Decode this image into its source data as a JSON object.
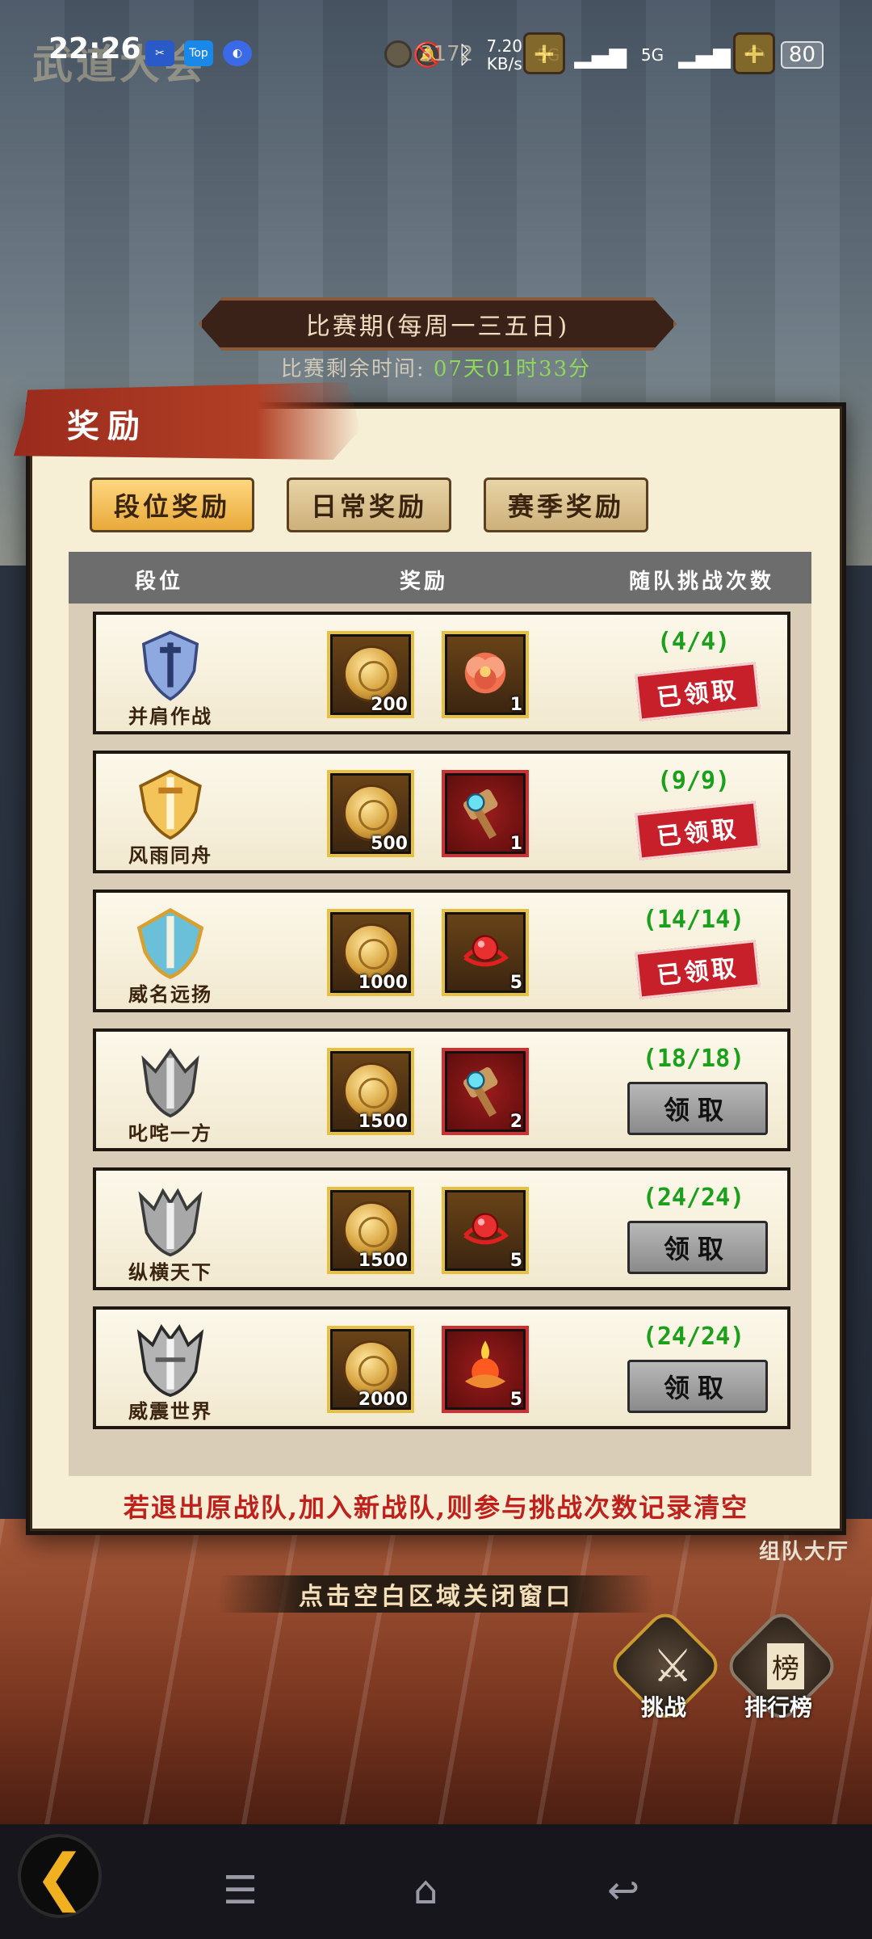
{
  "status_bar": {
    "time": "22:26",
    "net_speed": "7.20\nKB/s",
    "signal_1": "5G",
    "signal_2": "5G",
    "battery": "80",
    "app_icon_2": "Top"
  },
  "hud": {
    "game_title": "武道大会",
    "coins": "3172"
  },
  "period": {
    "banner": "比赛期(每周一三五日)",
    "remaining_label": "比赛剩余时间: ",
    "remaining_value": "07天01时33分"
  },
  "dialog": {
    "title": "奖励",
    "tabs": [
      {
        "label": "段位奖励",
        "active": true
      },
      {
        "label": "日常奖励",
        "active": false
      },
      {
        "label": "赛季奖励",
        "active": false
      }
    ],
    "columns": {
      "rank": "段位",
      "reward": "奖励",
      "count": "随队挑战次数"
    },
    "rows": [
      {
        "rank": "并肩作战",
        "coin_qty": "200",
        "item_qty": "1",
        "item": "peony-flower",
        "count": "(4/4)",
        "status": "已领取"
      },
      {
        "rank": "风雨同舟",
        "coin_qty": "500",
        "item_qty": "1",
        "item": "hammer",
        "count": "(9/9)",
        "status": "已领取"
      },
      {
        "rank": "威名远扬",
        "coin_qty": "1000",
        "item_qty": "5",
        "item": "red-gem",
        "count": "(14/14)",
        "status": "已领取"
      },
      {
        "rank": "叱咤一方",
        "coin_qty": "1500",
        "item_qty": "2",
        "item": "hammer",
        "count": "(18/18)",
        "status": "领取"
      },
      {
        "rank": "纵横天下",
        "coin_qty": "1500",
        "item_qty": "5",
        "item": "red-gem",
        "count": "(24/24)",
        "status": "领取"
      },
      {
        "rank": "威震世界",
        "coin_qty": "2000",
        "item_qty": "5",
        "item": "fire-lotus",
        "count": "(24/24)",
        "status": "领取"
      }
    ],
    "footer_note": "若退出原战队,加入新战队,则参与挑战次数记录清空"
  },
  "close_hint": "点击空白区域关闭窗口",
  "background_ui": {
    "team_hall": "组队大厅",
    "challenge": "挑战",
    "leaderboard": "排行榜",
    "leaderboard_badge": "榜"
  },
  "colors": {
    "claimed_red": "#c8202a",
    "count_green": "#1aa01a",
    "active_tab": "#f2c45a"
  }
}
